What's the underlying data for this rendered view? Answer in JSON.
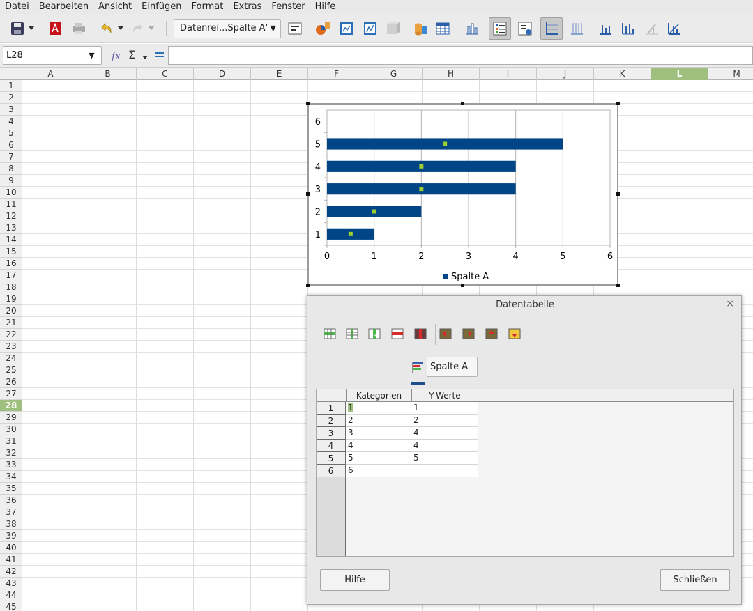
{
  "menubar": {
    "items": [
      "Datei",
      "Bearbeiten",
      "Ansicht",
      "Einfügen",
      "Format",
      "Extras",
      "Fenster",
      "Hilfe"
    ]
  },
  "toolbar": {
    "series_combo": "Datenrei...Spalte A'",
    "icons": [
      "save-icon",
      "export-pdf-icon",
      "print-icon",
      "undo-icon",
      "redo-icon",
      "format-selection-icon",
      "chart-type-icon",
      "chart-area-icon",
      "chart-wall-icon",
      "3d-view-icon",
      "data-ranges-icon",
      "data-table-icon",
      "bar-chart-icon",
      "legend-icon",
      "legend-position-icon",
      "horizontal-grid-icon",
      "vertical-grid-icon",
      "x-axis-icon",
      "y-axis-icon",
      "z-axis-icon",
      "all-axes-icon"
    ]
  },
  "formula_bar": {
    "name_box": "L28",
    "formula": ""
  },
  "sheet": {
    "columns": [
      "A",
      "B",
      "C",
      "D",
      "E",
      "F",
      "G",
      "H",
      "I",
      "J",
      "K",
      "L",
      "M"
    ],
    "selected_column": "L",
    "rows": [
      "1",
      "2",
      "3",
      "4",
      "5",
      "6",
      "7",
      "8",
      "9",
      "10",
      "11",
      "12",
      "13",
      "14",
      "15",
      "16",
      "17",
      "18",
      "19",
      "20",
      "21",
      "22",
      "23",
      "24",
      "25",
      "26",
      "27",
      "28",
      "29",
      "30",
      "31",
      "32",
      "33",
      "34",
      "35",
      "36",
      "37",
      "38",
      "39",
      "40",
      "41",
      "42",
      "43",
      "44",
      "45"
    ],
    "selected_row": "28"
  },
  "chart_data": {
    "type": "bar",
    "orientation": "horizontal",
    "categories": [
      "1",
      "2",
      "3",
      "4",
      "5",
      "6"
    ],
    "series": [
      {
        "name": "Spalte A",
        "values": [
          1,
          2,
          4,
          4,
          5,
          null
        ],
        "color": "#004586"
      }
    ],
    "xlim": [
      0,
      6
    ],
    "x_ticks": [
      "0",
      "1",
      "2",
      "3",
      "4",
      "5",
      "6"
    ],
    "grid": true,
    "legend_position": "bottom",
    "selection_marker_color": "#9acd32"
  },
  "dialog": {
    "title": "Datentabelle",
    "close_glyph": "×",
    "series_name": "Spalte A",
    "series_color": "#1f4f8a",
    "columns": [
      "Kategorien",
      "Y-Werte"
    ],
    "rows": [
      {
        "num": "1",
        "category": "1",
        "value": "1"
      },
      {
        "num": "2",
        "category": "2",
        "value": "2"
      },
      {
        "num": "3",
        "category": "3",
        "value": "4"
      },
      {
        "num": "4",
        "category": "4",
        "value": "4"
      },
      {
        "num": "5",
        "category": "5",
        "value": "5"
      },
      {
        "num": "6",
        "category": "6",
        "value": ""
      }
    ],
    "buttons": {
      "help": "Hilfe",
      "close": "Schließen"
    },
    "toolbar_icons": [
      "insert-row-icon",
      "insert-series-icon",
      "insert-text-column-icon",
      "delete-row-icon",
      "delete-series-icon",
      "move-series-left-icon",
      "move-series-right-icon",
      "move-row-up-icon",
      "move-row-down-icon"
    ]
  },
  "colors": {
    "accent_green": "#9fbf7f",
    "bar_blue": "#004586"
  }
}
